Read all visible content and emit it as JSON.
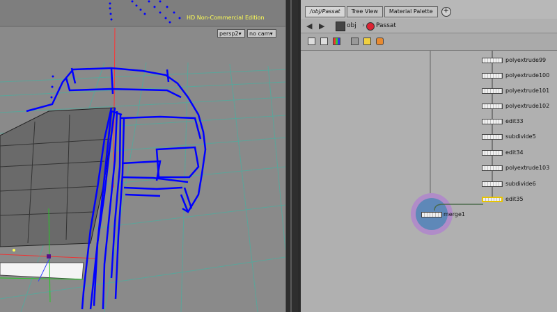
{
  "viewport": {
    "edition_label": "HD Non-Commercial Edition",
    "camera_dropdown": "persp2▾",
    "cam_dropdown": "no cam▾"
  },
  "network_panel": {
    "tabs": [
      {
        "label": "/obj/Passat",
        "active": true
      },
      {
        "label": "Tree View",
        "active": false
      },
      {
        "label": "Material Palette",
        "active": false
      }
    ],
    "add_tab_icon": "plus-circle-icon",
    "path": {
      "level1": "obj",
      "level2": "Passat"
    },
    "nodes": [
      {
        "name": "polyextrude99"
      },
      {
        "name": "polyextrude100"
      },
      {
        "name": "polyextrude101"
      },
      {
        "name": "polyextrude102"
      },
      {
        "name": "edit33"
      },
      {
        "name": "subdivide5"
      },
      {
        "name": "edit34"
      },
      {
        "name": "polyextrude103"
      },
      {
        "name": "subdivide6"
      },
      {
        "name": "edit35",
        "selected": true
      },
      {
        "name": "merge1",
        "current": true
      }
    ]
  },
  "colors": {
    "wireframe": "#0000ff",
    "selected_node": "#e8c400",
    "merge_highlight": "#b08cc8"
  }
}
